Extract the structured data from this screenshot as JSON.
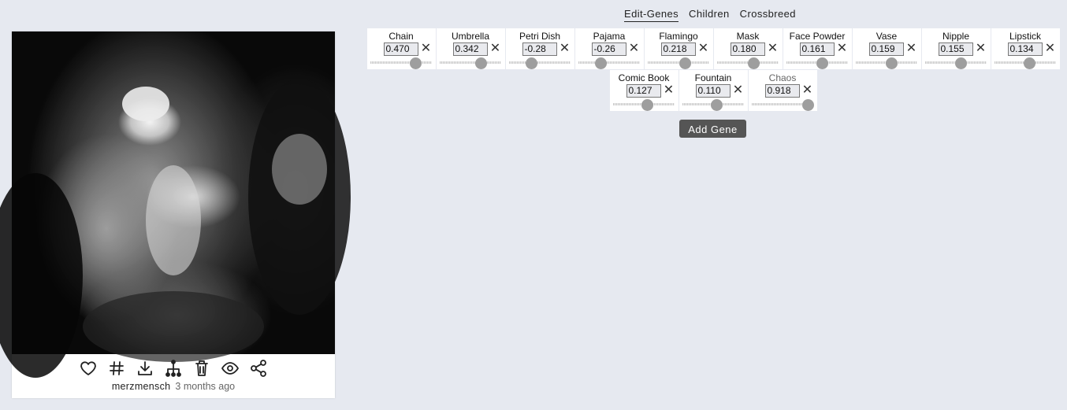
{
  "tabs": [
    {
      "label": "Edit-Genes",
      "active": true
    },
    {
      "label": "Children",
      "active": false
    },
    {
      "label": "Crossbreed",
      "active": false
    }
  ],
  "card": {
    "user": "merzmensch",
    "time_ago": "3 months ago",
    "actions": [
      {
        "icon": "heart-icon"
      },
      {
        "icon": "hashtag-icon"
      },
      {
        "icon": "download-icon"
      },
      {
        "icon": "family-tree-icon"
      },
      {
        "icon": "trash-icon"
      },
      {
        "icon": "eye-icon"
      },
      {
        "icon": "share-icon"
      }
    ]
  },
  "genes": [
    {
      "name": "Chain",
      "value": "0.470",
      "level": 0.735
    },
    {
      "name": "Umbrella",
      "value": "0.342",
      "level": 0.671
    },
    {
      "name": "Petri Dish",
      "value": "-0.28",
      "level": 0.36
    },
    {
      "name": "Pajama",
      "value": "-0.26",
      "level": 0.37
    },
    {
      "name": "Flamingo",
      "value": "0.218",
      "level": 0.609
    },
    {
      "name": "Mask",
      "value": "0.180",
      "level": 0.59
    },
    {
      "name": "Face Powder",
      "value": "0.161",
      "level": 0.58
    },
    {
      "name": "Vase",
      "value": "0.159",
      "level": 0.58
    },
    {
      "name": "Nipple",
      "value": "0.155",
      "level": 0.578
    },
    {
      "name": "Lipstick",
      "value": "0.134",
      "level": 0.567
    },
    {
      "name": "Comic Book",
      "value": "0.127",
      "level": 0.563
    },
    {
      "name": "Fountain",
      "value": "0.110",
      "level": 0.555
    },
    {
      "name": "Chaos",
      "value": "0.918",
      "level": 0.918,
      "muted": true
    }
  ],
  "add_gene_label": "Add Gene",
  "colors": {
    "background": "#e6e9f0",
    "button": "#555555",
    "thumb": "#9e9e9e"
  }
}
